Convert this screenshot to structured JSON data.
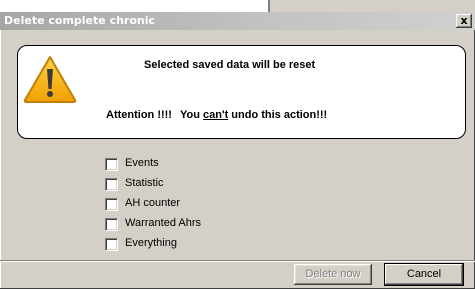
{
  "window": {
    "title": "Delete complete chronic",
    "close_label": "x"
  },
  "message": {
    "headline": "Selected saved data will be reset",
    "attention": "Attention !!!!",
    "undo_prefix": "You ",
    "undo_emphasis": "can't",
    "undo_suffix": " undo this action!!!"
  },
  "options": [
    {
      "label": "Events",
      "checked": false
    },
    {
      "label": "Statistic",
      "checked": false
    },
    {
      "label": "AH counter",
      "checked": false
    },
    {
      "label": "Warranted Ahrs",
      "checked": false
    },
    {
      "label": "Everything",
      "checked": false
    }
  ],
  "buttons": {
    "delete_label": "Delete now",
    "delete_enabled": false,
    "cancel_label": "Cancel"
  },
  "icons": {
    "warning": "warning-triangle-icon"
  },
  "colors": {
    "warning_fill": "#f7b500",
    "warning_edge": "#c47f00"
  }
}
